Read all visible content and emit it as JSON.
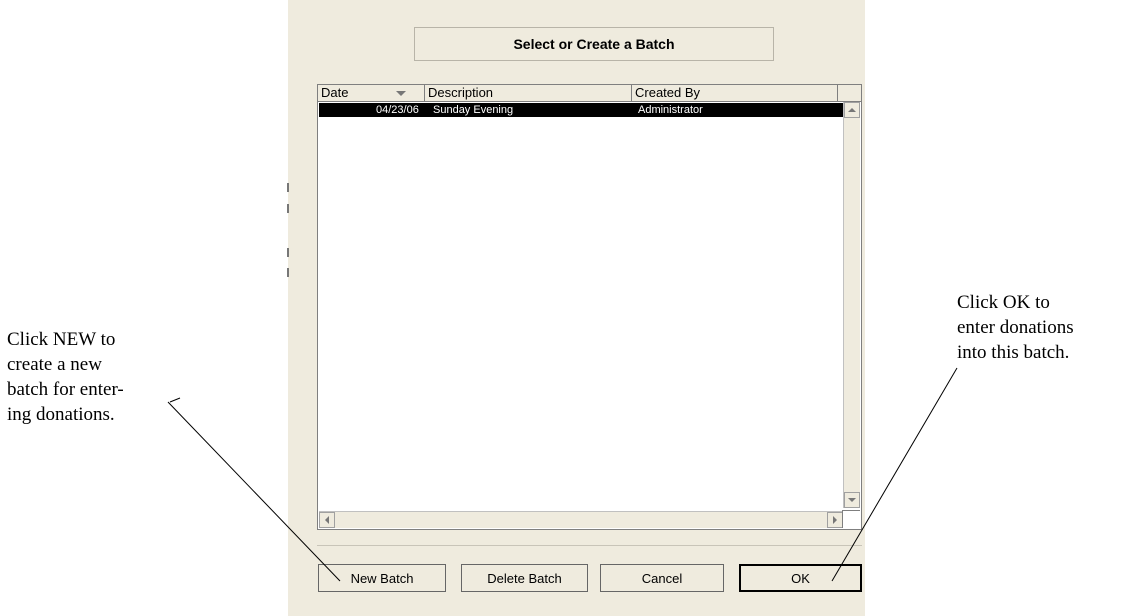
{
  "dialog": {
    "title": "Select or Create a Batch",
    "columns": [
      {
        "label": "Date"
      },
      {
        "label": "Description"
      },
      {
        "label": "Created By"
      }
    ],
    "rows": [
      {
        "date": "04/23/06",
        "description": "Sunday Evening",
        "created_by": "Administrator",
        "selected": true
      }
    ],
    "buttons": {
      "new": "New Batch",
      "delete": "Delete Batch",
      "cancel": "Cancel",
      "ok": "OK"
    }
  },
  "callouts": {
    "left": "Click NEW to\ncreate a new\nbatch for enter-\ning donations.",
    "right": "Click OK to\nenter donations\ninto this batch."
  },
  "colors": {
    "dialog_bg": "#efebde",
    "selection_bg": "#000000",
    "selection_text": "#ffffff"
  },
  "icons": [
    "sort-descending-icon",
    "scroll-up-icon",
    "scroll-down-icon",
    "scroll-left-icon",
    "scroll-right-icon"
  ]
}
